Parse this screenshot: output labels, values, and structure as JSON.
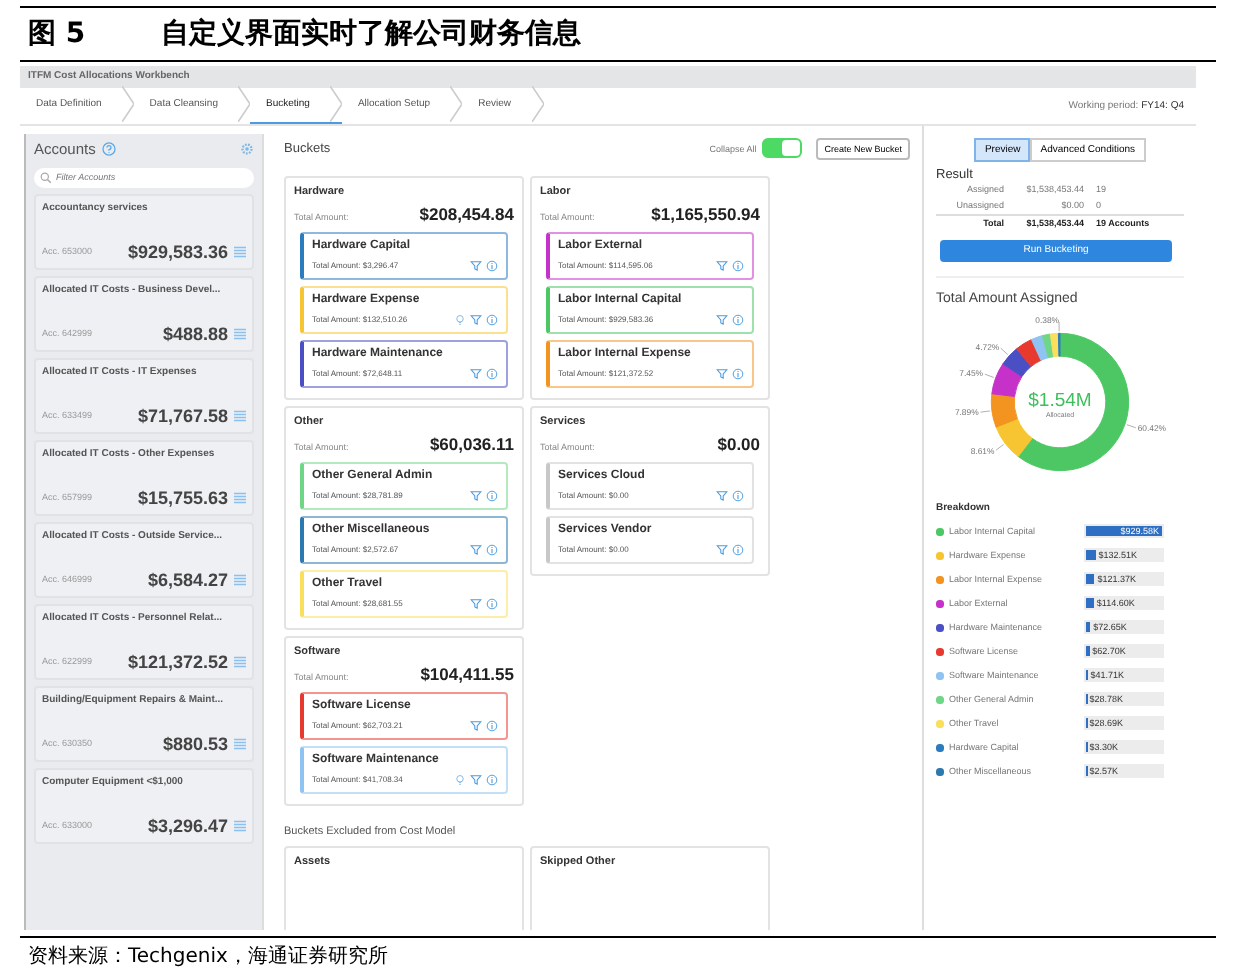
{
  "figure": {
    "number": "图 5",
    "title": "自定义界面实时了解公司财务信息",
    "source": "资料来源：Techgenix，海通证券研究所"
  },
  "window": {
    "title": "ITFM Cost Allocations Workbench"
  },
  "steps": [
    {
      "label": "Data Definition",
      "selected": false
    },
    {
      "label": "Data Cleansing",
      "selected": false
    },
    {
      "label": "Bucketing",
      "selected": true
    },
    {
      "label": "Allocation Setup",
      "selected": false
    },
    {
      "label": "Review",
      "selected": false
    }
  ],
  "working_period": {
    "label": "Working period:",
    "value": "FY14: Q4"
  },
  "accounts": {
    "title": "Accounts",
    "search": {
      "placeholder": "Filter Accounts"
    },
    "items": [
      {
        "name": "Accountancy services",
        "number": "Acc. 653000",
        "amount": "$929,583.36"
      },
      {
        "name": "Allocated IT Costs - Business Devel...",
        "number": "Acc. 642999",
        "amount": "$488.88"
      },
      {
        "name": "Allocated IT Costs - IT Expenses",
        "number": "Acc. 633499",
        "amount": "$71,767.58"
      },
      {
        "name": "Allocated IT Costs - Other Expenses",
        "number": "Acc. 657999",
        "amount": "$15,755.63"
      },
      {
        "name": "Allocated IT Costs - Outside Service...",
        "number": "Acc. 646999",
        "amount": "$6,584.27"
      },
      {
        "name": "Allocated IT Costs - Personnel Relat...",
        "number": "Acc. 622999",
        "amount": "$121,372.52"
      },
      {
        "name": "Building/Equipment Repairs & Maint...",
        "number": "Acc. 630350",
        "amount": "$880.53"
      },
      {
        "name": "Computer Equipment <$1,000",
        "number": "Acc. 633000",
        "amount": "$3,296.47"
      }
    ]
  },
  "buckets": {
    "title": "Buckets",
    "collapse": {
      "label": "Collapse All",
      "on": true
    },
    "create_button": "Create New Bucket",
    "groups": [
      {
        "name": "Hardware",
        "total_label": "Total Amount:",
        "total": "$208,454.84",
        "items": [
          {
            "name": "Hardware Capital",
            "amount_label": "Total Amount:",
            "amount": "$3,296.47",
            "color": "#2b7bbf",
            "lightbulb": false
          },
          {
            "name": "Hardware Expense",
            "amount_label": "Total Amount:",
            "amount": "$132,510.26",
            "color": "#f7c531",
            "lightbulb": true
          },
          {
            "name": "Hardware Maintenance",
            "amount_label": "Total Amount:",
            "amount": "$72,648.11",
            "color": "#4b4fc4",
            "lightbulb": false
          }
        ]
      },
      {
        "name": "Labor",
        "total_label": "Total Amount:",
        "total": "$1,165,550.94",
        "items": [
          {
            "name": "Labor External",
            "amount_label": "Total Amount:",
            "amount": "$114,595.06",
            "color": "#c531c9",
            "lightbulb": false
          },
          {
            "name": "Labor Internal Capital",
            "amount_label": "Total Amount:",
            "amount": "$929,583.36",
            "color": "#4cc764",
            "lightbulb": false
          },
          {
            "name": "Labor Internal Expense",
            "amount_label": "Total Amount:",
            "amount": "$121,372.52",
            "color": "#f39320",
            "lightbulb": false
          }
        ]
      },
      {
        "name": "Other",
        "total_label": "Total Amount:",
        "total": "$60,036.11",
        "items": [
          {
            "name": "Other General Admin",
            "amount_label": "Total Amount:",
            "amount": "$28,781.89",
            "color": "#6fd688",
            "lightbulb": false
          },
          {
            "name": "Other Miscellaneous",
            "amount_label": "Total Amount:",
            "amount": "$2,572.67",
            "color": "#2c79b0",
            "lightbulb": false
          },
          {
            "name": "Other Travel",
            "amount_label": "Total Amount:",
            "amount": "$28,681.55",
            "color": "#f9df5c",
            "lightbulb": false
          }
        ]
      },
      {
        "name": "Services",
        "total_label": "Total Amount:",
        "total": "$0.00",
        "items": [
          {
            "name": "Services Cloud",
            "amount_label": "Total Amount:",
            "amount": "$0.00",
            "color": "#c8c8c8",
            "lightbulb": false
          },
          {
            "name": "Services Vendor",
            "amount_label": "Total Amount:",
            "amount": "$0.00",
            "color": "#c8c8c8",
            "lightbulb": false
          }
        ]
      },
      {
        "name": "Software",
        "total_label": "Total Amount:",
        "total": "$104,411.55",
        "items": [
          {
            "name": "Software License",
            "amount_label": "Total Amount:",
            "amount": "$62,703.21",
            "color": "#e8392f",
            "lightbulb": false
          },
          {
            "name": "Software Maintenance",
            "amount_label": "Total Amount:",
            "amount": "$41,708.34",
            "color": "#8ec3f2",
            "lightbulb": true
          }
        ]
      }
    ]
  },
  "excluded": {
    "title": "Buckets Excluded from Cost Model",
    "groups": [
      {
        "name": "Assets"
      },
      {
        "name": "Skipped Other"
      }
    ]
  },
  "view_tabs": [
    {
      "label": "Preview",
      "selected": true
    },
    {
      "label": "Advanced Conditions",
      "selected": false
    }
  ],
  "result": {
    "title": "Result",
    "rows": [
      {
        "label": "Assigned",
        "amount": "$1,538,453.44",
        "count": "19",
        "total": false
      },
      {
        "label": "Unassigned",
        "amount": "$0.00",
        "count": "0",
        "total": false
      },
      {
        "label": "Total",
        "amount": "$1,538,453.44",
        "count": "19 Accounts",
        "total": true
      }
    ]
  },
  "run_button": "Run Bucketing",
  "assigned": {
    "title": "Total Amount Assigned",
    "center_value": "$1.54M",
    "center_label": "Allocated",
    "chart_data": {
      "type": "donut",
      "series": [
        {
          "values": [
            60.42,
            8.61,
            7.89,
            7.45,
            4.72,
            4.08,
            2.71,
            1.87,
            1.87,
            0.38
          ]
        }
      ],
      "value_labels": [
        "60.42%",
        "8.61%",
        "7.89%",
        "7.45%",
        "4.72%",
        null,
        null,
        null,
        null,
        "0.38%"
      ]
    }
  },
  "breakdown": {
    "title": "Breakdown",
    "items": [
      {
        "name": "Labor Internal Capital",
        "value": "$929.58K",
        "level": 1,
        "color": "#4cc764"
      },
      {
        "name": "Hardware Expense",
        "value": "$132.51K",
        "level": 0.143,
        "color": "#f7c531"
      },
      {
        "name": "Labor Internal Expense",
        "value": "$121.37K",
        "level": 0.131,
        "color": "#f39320"
      },
      {
        "name": "Labor External",
        "value": "$114.60K",
        "level": 0.123,
        "color": "#c531c9"
      },
      {
        "name": "Hardware Maintenance",
        "value": "$72.65K",
        "level": 0.078,
        "color": "#4b4fc4"
      },
      {
        "name": "Software License",
        "value": "$62.70K",
        "level": 0.067,
        "color": "#e8392f"
      },
      {
        "name": "Software Maintenance",
        "value": "$41.71K",
        "level": 0.045,
        "color": "#8ec3f2"
      },
      {
        "name": "Other General Admin",
        "value": "$28.78K",
        "level": 0.031,
        "color": "#6fd688"
      },
      {
        "name": "Other Travel",
        "value": "$28.69K",
        "level": 0.031,
        "color": "#f9df5c"
      },
      {
        "name": "Hardware Capital",
        "value": "$3.30K",
        "level": 0.004,
        "color": "#2b7bbf"
      },
      {
        "name": "Other Miscellaneous",
        "value": "$2.57K",
        "level": 0.003,
        "color": "#2c79b0"
      }
    ]
  }
}
